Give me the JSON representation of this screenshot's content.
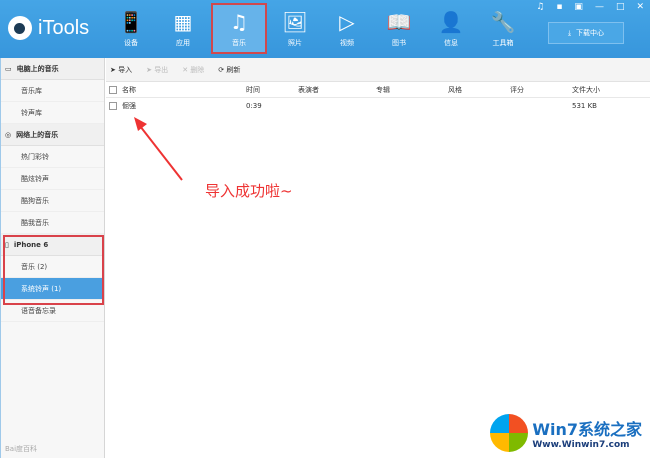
{
  "app": {
    "title": "iTools"
  },
  "nav": [
    {
      "label": "设备",
      "icon": "📱"
    },
    {
      "label": "应用",
      "icon": "▦"
    },
    {
      "label": "音乐",
      "icon": "♫"
    },
    {
      "label": "照片",
      "icon": "🖼"
    },
    {
      "label": "视频",
      "icon": "▷"
    },
    {
      "label": "图书",
      "icon": "📖"
    },
    {
      "label": "信息",
      "icon": "👤"
    },
    {
      "label": "工具箱",
      "icon": "🔧"
    }
  ],
  "window_controls": [
    "♫",
    "▪",
    "▣",
    "—",
    "□",
    "✕"
  ],
  "download_center": "下载中心",
  "sidebar": {
    "pc_music": "电脑上的音乐",
    "pc_items": [
      "音乐库",
      "铃声库"
    ],
    "net_music": "网络上的音乐",
    "net_items": [
      "热门彩铃",
      "酷炫铃声",
      "酷狗音乐",
      "酷我音乐"
    ],
    "device": "iPhone 6",
    "device_items": [
      "音乐 (2)",
      "系统铃声 (1)",
      "语音备忘录"
    ]
  },
  "toolbar": {
    "import": "导入",
    "export": "导出",
    "delete": "删除",
    "refresh": "刷新"
  },
  "columns": [
    "名称",
    "时间",
    "表演者",
    "专辑",
    "风格",
    "评分",
    "文件大小"
  ],
  "rows": [
    {
      "name": "倔强",
      "time": "0:39",
      "artist": "",
      "album": "",
      "genre": "",
      "rating": "",
      "size": "531 KB"
    }
  ],
  "annotation": "导入成功啦~",
  "watermark": {
    "brand": "Win7系统之家",
    "url": "Www.Winwin7.com"
  },
  "baidu_mark": "Bai度百科"
}
